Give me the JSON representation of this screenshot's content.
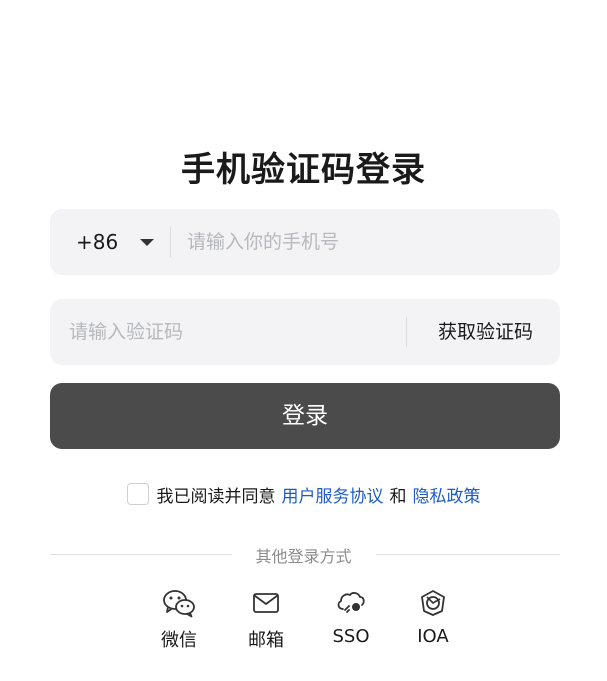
{
  "title": "手机验证码登录",
  "phone": {
    "country_code": "+86",
    "placeholder": "请输入你的手机号",
    "value": ""
  },
  "code": {
    "placeholder": "请输入验证码",
    "value": "",
    "get_code_label": "获取验证码"
  },
  "login_button": "登录",
  "agreement": {
    "prefix": "我已阅读并同意",
    "terms_link": "用户服务协议",
    "and": "和",
    "privacy_link": "隐私政策",
    "checked": false
  },
  "other_methods": {
    "label": "其他登录方式",
    "items": [
      {
        "label": "微信",
        "icon": "wechat-icon"
      },
      {
        "label": "邮箱",
        "icon": "mail-icon"
      },
      {
        "label": "SSO",
        "icon": "sso-icon"
      },
      {
        "label": "IOA",
        "icon": "ioa-icon"
      }
    ]
  },
  "colors": {
    "primary_button": "#4b4b4b",
    "link": "#1f5cc2",
    "field_background": "#f3f3f6"
  }
}
